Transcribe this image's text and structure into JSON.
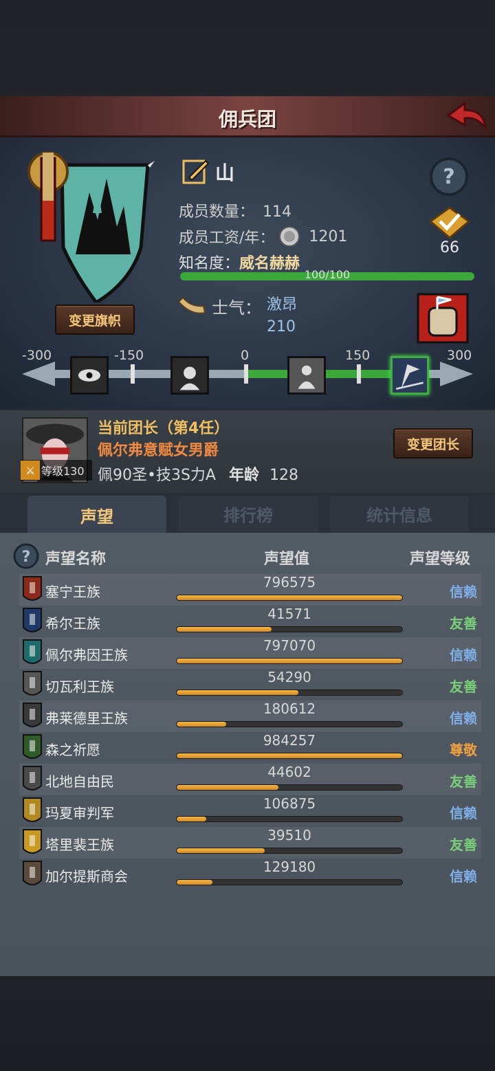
{
  "header": {
    "title": "佣兵团"
  },
  "guild": {
    "name": "山",
    "members_label": "成员数量：",
    "members": "114",
    "salary_label": "成员工资/年：",
    "salary": "1201",
    "fame_label": "知名度：",
    "fame_value": "威名赫赫",
    "fame_progress_text": "100/100",
    "fame_progress": 1.0,
    "rank": "66",
    "change_banner_label": "变更旗帜"
  },
  "morale": {
    "label": "士气：",
    "state": "激昂",
    "value": "210",
    "ticks": [
      "-300",
      "-150",
      "0",
      "150",
      "300"
    ]
  },
  "leader": {
    "title": "当前团长（第4任）",
    "name": "佩尔弗意赋女男爵",
    "level": "等级130",
    "stats": "佩90圣•技3S力A",
    "age_label": "年龄",
    "age": "128",
    "change_label": "变更团长"
  },
  "tabs": [
    "声望",
    "排行榜",
    "统计信息"
  ],
  "table": {
    "headers": [
      "声望名称",
      "声望值",
      "声望等级"
    ],
    "rows": [
      {
        "name": "塞宁王族",
        "value": "796575",
        "fill": 1.0,
        "level": "信赖",
        "color": "#7fb0e8",
        "icon": "#8a2a1a"
      },
      {
        "name": "希尔王族",
        "value": "41571",
        "fill": 0.42,
        "level": "友善",
        "color": "#7ad07a",
        "icon": "#1f3a66"
      },
      {
        "name": "佩尔弗因王族",
        "value": "797070",
        "fill": 1.0,
        "level": "信赖",
        "color": "#7fb0e8",
        "icon": "#1f6a6a"
      },
      {
        "name": "切瓦利王族",
        "value": "54290",
        "fill": 0.54,
        "level": "友善",
        "color": "#7ad07a",
        "icon": "#555555"
      },
      {
        "name": "弗莱德里王族",
        "value": "180612",
        "fill": 0.22,
        "level": "信赖",
        "color": "#7fb0e8",
        "icon": "#3a3a3a"
      },
      {
        "name": "森之祈愿",
        "value": "984257",
        "fill": 1.0,
        "level": "尊敬",
        "color": "#f0a040",
        "icon": "#2f5a2a"
      },
      {
        "name": "北地自由民",
        "value": "44602",
        "fill": 0.45,
        "level": "友善",
        "color": "#7ad07a",
        "icon": "#4a4a4a"
      },
      {
        "name": "玛夏审判军",
        "value": "106875",
        "fill": 0.13,
        "level": "信赖",
        "color": "#7fb0e8",
        "icon": "#b08a20"
      },
      {
        "name": "塔里裴王族",
        "value": "39510",
        "fill": 0.39,
        "level": "友善",
        "color": "#7ad07a",
        "icon": "#c89a20"
      },
      {
        "name": "加尔提斯商会",
        "value": "129180",
        "fill": 0.16,
        "level": "信赖",
        "color": "#7fb0e8",
        "icon": "#5a4a3a"
      }
    ]
  }
}
